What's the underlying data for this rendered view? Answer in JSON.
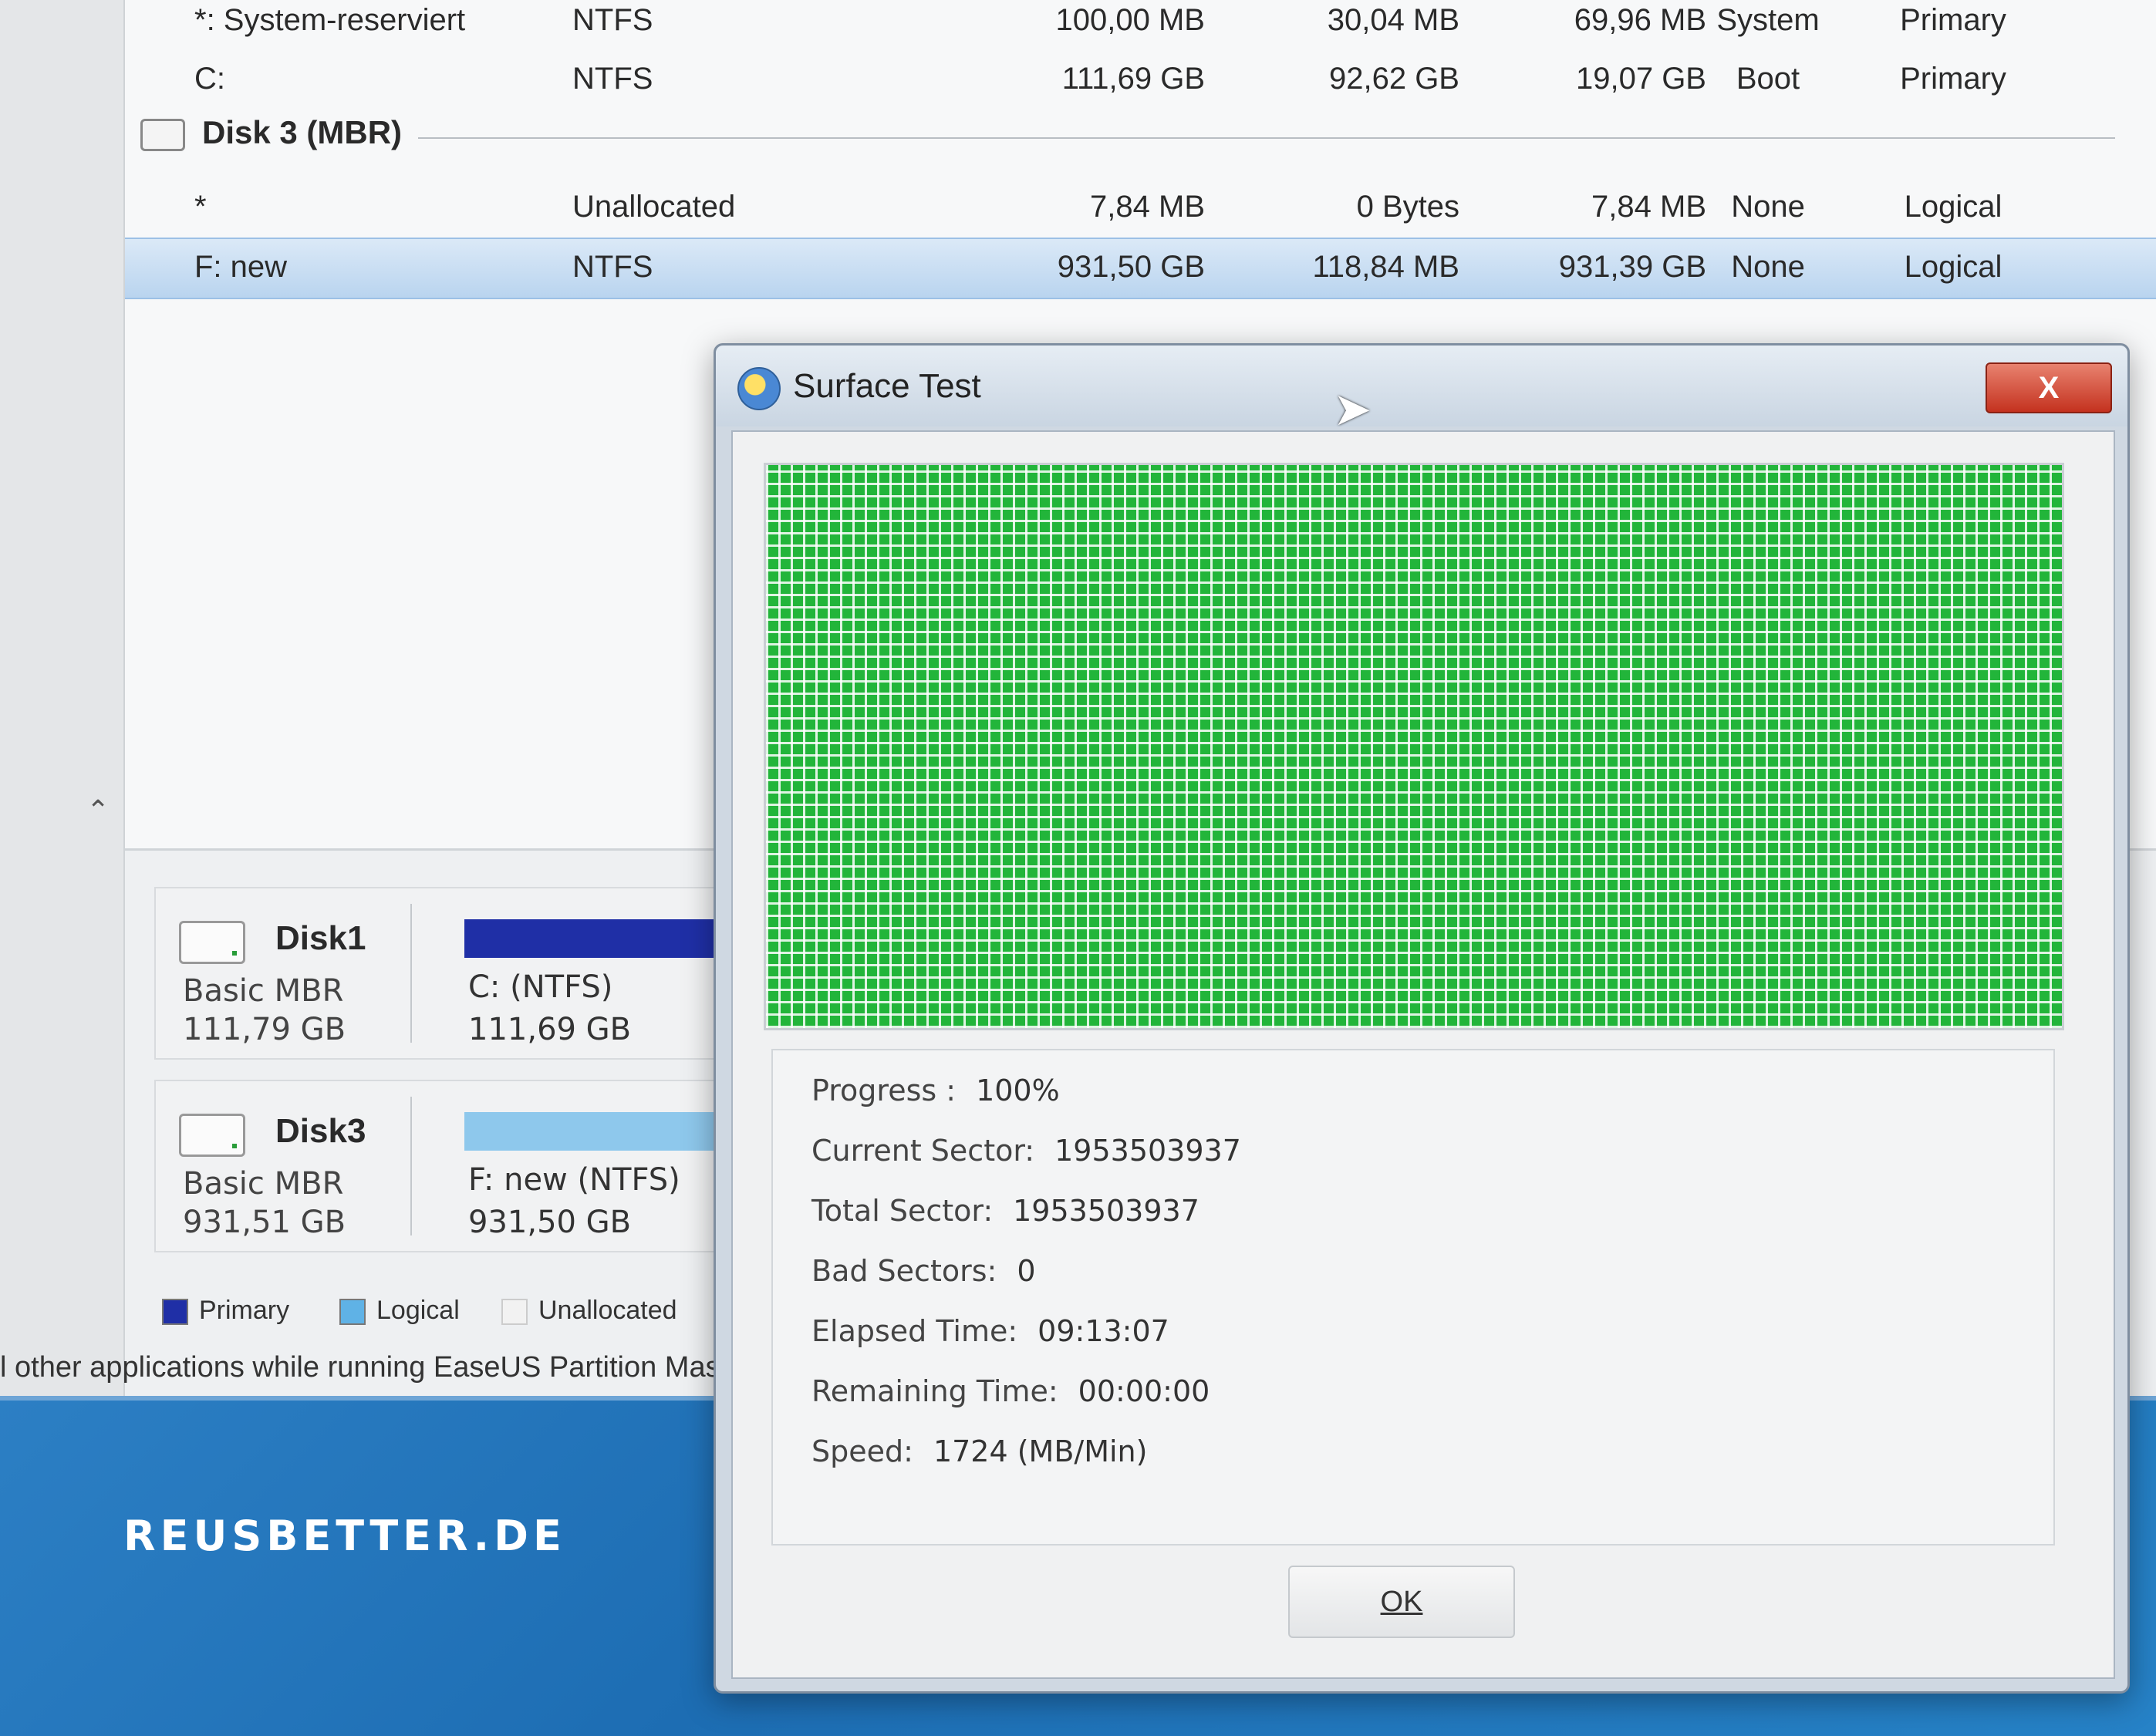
{
  "background_app": {
    "partitions": [
      {
        "name": "*: System-reserviert",
        "fs": "NTFS",
        "capacity": "100,00 MB",
        "used": "30,04 MB",
        "unused": "69,96 MB",
        "status": "System",
        "type": "Primary"
      },
      {
        "name": "C:",
        "fs": "NTFS",
        "capacity": "111,69 GB",
        "used": "92,62 GB",
        "unused": "19,07 GB",
        "status": "Boot",
        "type": "Primary"
      }
    ],
    "disk3_label": "Disk 3 (MBR)",
    "disk3_partitions": [
      {
        "name": "*",
        "fs": "Unallocated",
        "capacity": "7,84 MB",
        "used": "0 Bytes",
        "unused": "7,84 MB",
        "status": "None",
        "type": "Logical"
      },
      {
        "name": "F: new",
        "fs": "NTFS",
        "capacity": "931,50 GB",
        "used": "118,84 MB",
        "unused": "931,39 GB",
        "status": "None",
        "type": "Logical"
      }
    ],
    "disk_map": [
      {
        "name": "Disk1",
        "type": "Basic MBR",
        "size": "111,79 GB",
        "partition_label": "C: (NTFS)",
        "partition_size": "111,69 GB",
        "bar_color": "#1f2fa6"
      },
      {
        "name": "Disk3",
        "type": "Basic MBR",
        "size": "931,51 GB",
        "partition_label": "F: new (NTFS)",
        "partition_size": "931,50 GB",
        "bar_color": "#8ec8ec"
      }
    ],
    "legend": {
      "primary": "Primary",
      "logical": "Logical",
      "unallocated": "Unallocated"
    },
    "status_text": "l other applications while running EaseUS Partition Maste"
  },
  "dialog": {
    "title": "Surface Test",
    "close_label": "X",
    "info": {
      "progress_label": "Progress :",
      "progress_value": "100%",
      "current_sector_label": "Current Sector:",
      "current_sector_value": "1953503937",
      "total_sector_label": "Total Sector:",
      "total_sector_value": "1953503937",
      "bad_sectors_label": "Bad Sectors:",
      "bad_sectors_value": "0",
      "elapsed_label": "Elapsed Time:",
      "elapsed_value": "09:13:07",
      "remaining_label": "Remaining Time:",
      "remaining_value": "00:00:00",
      "speed_label": "Speed:",
      "speed_value": "1724 (MB/Min)"
    },
    "ok_label": "OK",
    "sector_map_color": "#22b53a"
  },
  "watermark": "REUSBETTER.DE"
}
